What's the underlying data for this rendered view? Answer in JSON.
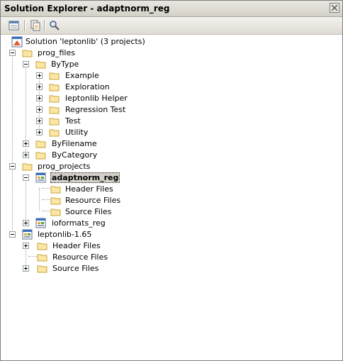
{
  "window": {
    "title": "Solution Explorer - adaptnorm_reg"
  },
  "toolbar": {
    "buttons": [
      {
        "icon": "properties-icon"
      },
      {
        "icon": "show-all-files-icon"
      },
      {
        "icon": "refresh-icon"
      }
    ]
  },
  "tree": {
    "solution": "Solution 'leptonlib' (3 projects)",
    "prog_files": "prog_files",
    "bytype": "ByType",
    "example": "Example",
    "exploration": "Exploration",
    "helper": "leptonlib Helper",
    "regression": "Regression Test",
    "test": "Test",
    "utility": "Utility",
    "byfilename": "ByFilename",
    "bycategory": "ByCategory",
    "prog_projects": "prog_projects",
    "adaptnorm": "adaptnorm_reg",
    "header1": "Header Files",
    "resource1": "Resource Files",
    "source1": "Source Files",
    "ioformats": "ioformats_reg",
    "leptonlib": "leptonlib-1.65",
    "header2": "Header Files",
    "resource2": "Resource Files",
    "source2": "Source Files"
  }
}
